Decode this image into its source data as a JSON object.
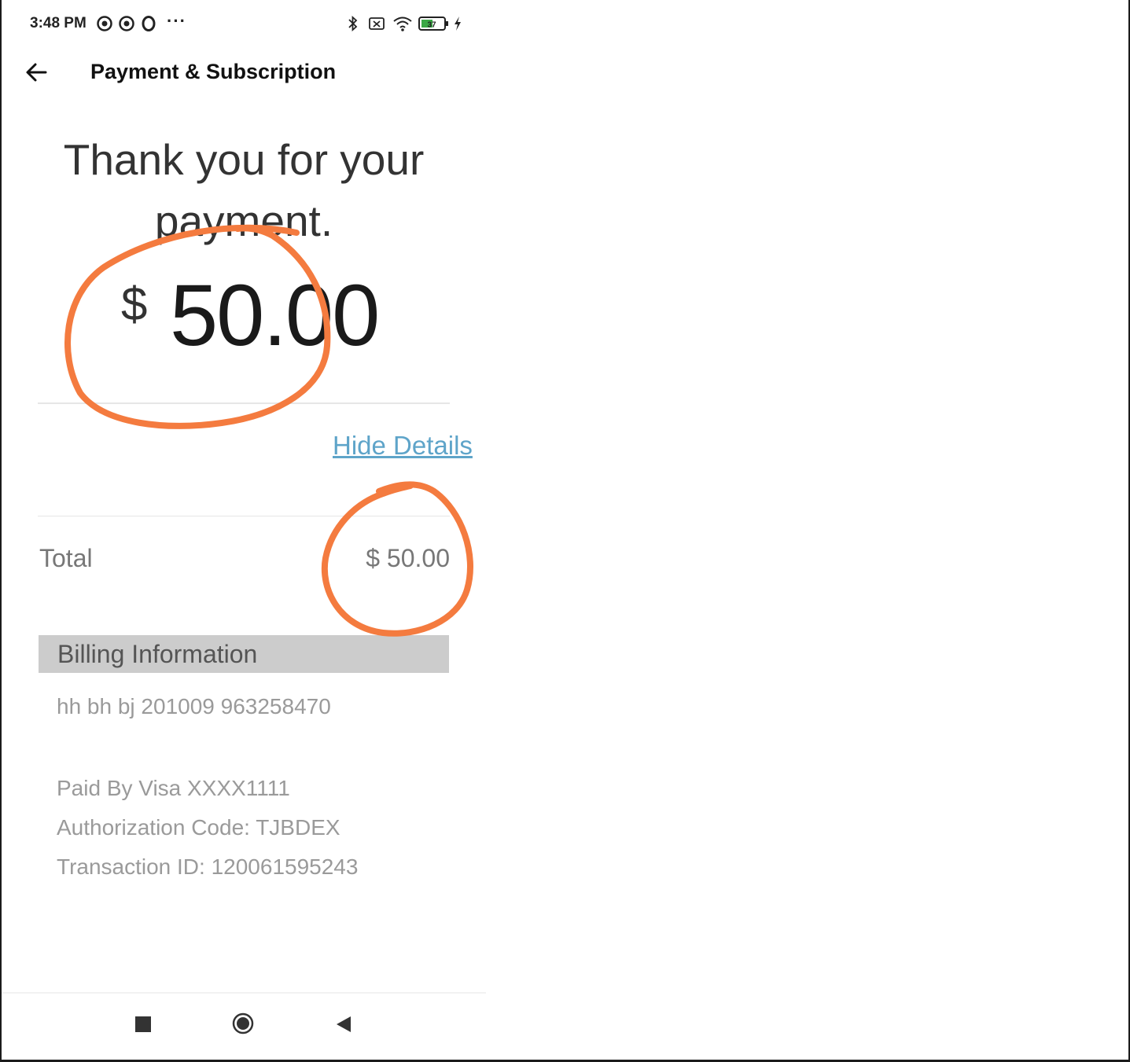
{
  "status_bar": {
    "time": "3:48 PM",
    "more": "···",
    "battery": "37"
  },
  "header": {
    "title": "Payment & Subscription"
  },
  "main": {
    "thanks": "Thank you for your payment.",
    "currency_symbol": "$",
    "amount": "50.00",
    "hide_details": "Hide Details",
    "total_label": "Total",
    "total_value": "$ 50.00",
    "billing_header": "Billing Information",
    "billing_address": "hh bh bj 201009 963258470",
    "paid_by": "Paid By Visa XXXX1111",
    "auth_code": "Authorization Code: TJBDEX",
    "transaction_id": "Transaction ID: 120061595243"
  },
  "annotation_color": "#f47b3f",
  "link_color": "#5ea4c9",
  "icons": [
    "back-arrow-icon",
    "bluetooth-icon",
    "wifi-icon",
    "battery-icon",
    "charging-icon",
    "stop-square-icon",
    "home-circle-icon",
    "back-triangle-icon"
  ]
}
